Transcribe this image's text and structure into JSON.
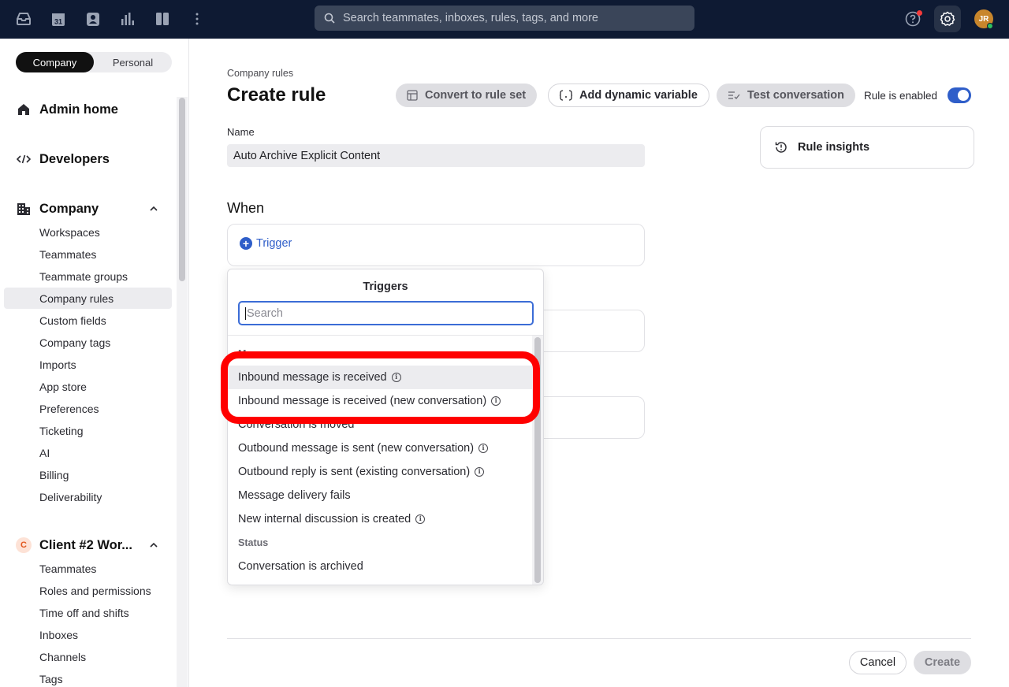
{
  "topbar": {
    "search_placeholder": "Search teammates, inboxes, rules, tags, and more",
    "calendar_day": "31",
    "avatar_initials": "JR"
  },
  "sidebar": {
    "segment": {
      "company": "Company",
      "personal": "Personal"
    },
    "admin_home": "Admin home",
    "developers": "Developers",
    "company_section": "Company",
    "company_items": [
      "Workspaces",
      "Teammates",
      "Teammate groups",
      "Company rules",
      "Custom fields",
      "Company tags",
      "Imports",
      "App store",
      "Preferences",
      "Ticketing",
      "AI",
      "Billing",
      "Deliverability"
    ],
    "client_badge": "C",
    "client_section": "Client #2 Wor...",
    "client_items": [
      "Teammates",
      "Roles and permissions",
      "Time off and shifts",
      "Inboxes",
      "Channels",
      "Tags"
    ]
  },
  "main": {
    "breadcrumb": "Company rules",
    "title": "Create rule",
    "convert_btn": "Convert to rule set",
    "dynamic_btn": "Add dynamic variable",
    "test_btn": "Test conversation",
    "enabled_label": "Rule is enabled",
    "enabled": true,
    "name_label": "Name",
    "name_value": "Auto Archive Explicit Content",
    "insights": "Rule insights",
    "when": "When",
    "trigger": "Trigger",
    "cancel": "Cancel",
    "create": "Create"
  },
  "dropdown": {
    "title": "Triggers",
    "search_placeholder": "Search",
    "group_messages_partial": "M",
    "items": [
      {
        "label": "Inbound message is received",
        "info": true
      },
      {
        "label": "Inbound message is received (new conversation)",
        "info": true
      },
      {
        "label": "Conversation is moved",
        "info": false
      },
      {
        "label": "Outbound message is sent (new conversation)",
        "info": true
      },
      {
        "label": "Outbound reply is sent (existing conversation)",
        "info": true
      },
      {
        "label": "Message delivery fails",
        "info": false
      },
      {
        "label": "New internal discussion is created",
        "info": true
      }
    ],
    "group_status": "Status",
    "status_items": [
      "Conversation is archived"
    ]
  },
  "colors": {
    "topbar": "#0e1a33",
    "accent": "#2f5ec9",
    "highlight": "#ff0000"
  }
}
